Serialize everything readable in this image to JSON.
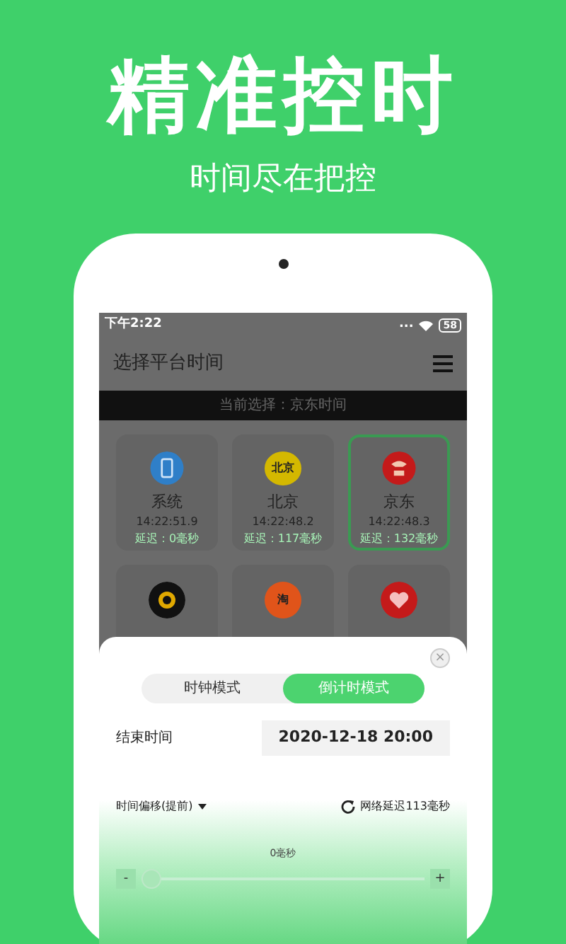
{
  "headline": "精准控时",
  "subtitle": "时间尽在把控",
  "status_bar": {
    "time": "下午2:22",
    "dots": "...",
    "battery": "58"
  },
  "header": {
    "title": "选择平台时间"
  },
  "banner": "当前选择：京东时间",
  "platforms": [
    {
      "kind": "phone",
      "name": "系统",
      "time": "14:22:51.9",
      "delay": "延迟：0毫秒",
      "color": "#2f7fc8",
      "selected": false
    },
    {
      "kind": "text",
      "icon_text": "北京",
      "name": "北京",
      "time": "14:22:48.2",
      "delay": "延迟：117毫秒",
      "color": "#d4b800",
      "selected": false
    },
    {
      "kind": "dog",
      "name": "京东",
      "time": "14:22:48.3",
      "delay": "延迟：132毫秒",
      "color": "#c41a1a",
      "selected": true
    },
    {
      "kind": "flower",
      "color": "#111111",
      "selected": false
    },
    {
      "kind": "text",
      "icon_text": "淘",
      "color": "#e0541a",
      "selected": false
    },
    {
      "kind": "heart",
      "color": "#c41a1a",
      "selected": false
    }
  ],
  "sheet": {
    "close": "×",
    "modes": [
      {
        "label": "时钟模式",
        "selected": false
      },
      {
        "label": "倒计时模式",
        "selected": true
      }
    ],
    "end_time_label": "结束时间",
    "end_time_value": "2020-12-18 20:00",
    "offset_label": "时间偏移(提前)",
    "network_delay": "网络延迟113毫秒",
    "slider": {
      "reading": "0毫秒",
      "level": 0,
      "minus": "-",
      "plus": "+"
    }
  }
}
